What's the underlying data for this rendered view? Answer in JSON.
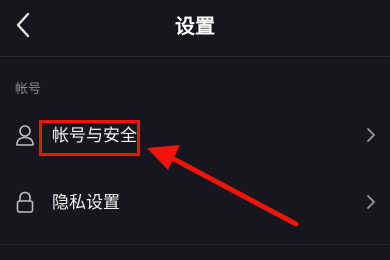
{
  "header": {
    "title": "设置",
    "back_icon": "chevron-left-icon"
  },
  "section": {
    "label": "帐号"
  },
  "items": [
    {
      "label": "帐号与安全",
      "icon": "person-icon",
      "chevron": "chevron-right-icon",
      "highlighted": true
    },
    {
      "label": "隐私设置",
      "icon": "lock-icon",
      "chevron": "chevron-right-icon",
      "highlighted": false
    }
  ],
  "annotation": {
    "color": "#f0140a",
    "type": "box-and-arrow"
  },
  "colors": {
    "background": "#16171e",
    "text_primary": "#f2f2f2",
    "text_secondary": "#8a8b91"
  }
}
